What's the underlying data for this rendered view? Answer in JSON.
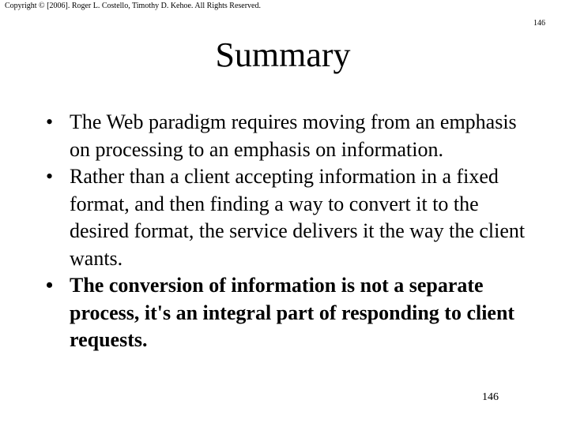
{
  "header": {
    "copyright": "Copyright © [2006]. Roger L. Costello, Timothy D. Kehoe. All Rights Reserved.",
    "page_number": "146"
  },
  "slide": {
    "title": "Summary",
    "bullet_glyph": "•",
    "bullets": [
      {
        "text": "The Web paradigm requires moving from an emphasis on processing to an emphasis on information.",
        "bold": false
      },
      {
        "text": "Rather than a client accepting information in a fixed format, and then finding a way to convert it to the desired format, the service delivers it the way the client wants.",
        "bold": false
      },
      {
        "text": "The conversion of information is not a separate process, it's an integral part of responding to client requests.",
        "bold": true
      }
    ]
  },
  "footer": {
    "page_number": "146"
  }
}
